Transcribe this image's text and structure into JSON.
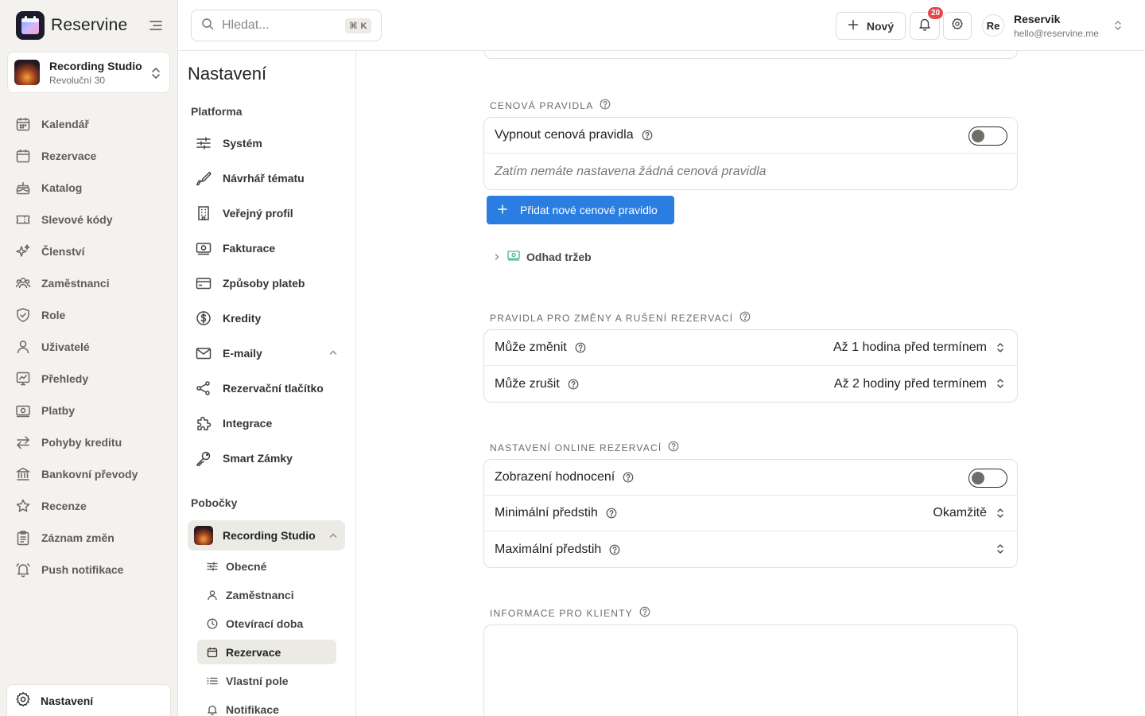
{
  "app": {
    "name": "Reservine"
  },
  "studio": {
    "name": "Recording Studio",
    "address": "Revoluční 30"
  },
  "nav": {
    "items": [
      {
        "label": "Kalendář",
        "icon": "calendar-icon"
      },
      {
        "label": "Rezervace",
        "icon": "calendar-check-icon"
      },
      {
        "label": "Katalog",
        "icon": "cake-icon"
      },
      {
        "label": "Slevové kódy",
        "icon": "ticket-icon"
      },
      {
        "label": "Členství",
        "icon": "sparkles-icon"
      },
      {
        "label": "Zaměstnanci",
        "icon": "users-icon"
      },
      {
        "label": "Role",
        "icon": "shield-icon"
      },
      {
        "label": "Uživatelé",
        "icon": "user-icon"
      },
      {
        "label": "Přehledy",
        "icon": "chart-icon"
      },
      {
        "label": "Platby",
        "icon": "banknote-icon"
      },
      {
        "label": "Pohyby kreditu",
        "icon": "arrows-icon"
      },
      {
        "label": "Bankovní převody",
        "icon": "bank-icon"
      },
      {
        "label": "Recenze",
        "icon": "star-icon"
      },
      {
        "label": "Záznam změn",
        "icon": "clipboard-icon"
      },
      {
        "label": "Push notifikace",
        "icon": "bell-ring-icon"
      }
    ],
    "bottom": {
      "label": "Nastavení",
      "icon": "gear-icon"
    }
  },
  "topbar": {
    "search_placeholder": "Hledat...",
    "shortcut": "⌘ K",
    "new_label": "Nový",
    "notification_count": "20",
    "user_initials": "Re",
    "user_name": "Reservik",
    "user_email": "hello@reservine.me"
  },
  "settings": {
    "title": "Nastavení",
    "platform_header": "Platforma",
    "platform_items": [
      {
        "label": "Systém",
        "icon": "sliders-icon"
      },
      {
        "label": "Návrhář tématu",
        "icon": "brush-icon"
      },
      {
        "label": "Veřejný profil",
        "icon": "building-icon"
      },
      {
        "label": "Fakturace",
        "icon": "invoice-icon"
      },
      {
        "label": "Způsoby plateb",
        "icon": "credit-card-icon"
      },
      {
        "label": "Kredity",
        "icon": "dollar-circle-icon"
      },
      {
        "label": "E-maily",
        "icon": "mail-icon"
      },
      {
        "label": "Rezervační tlačítko",
        "icon": "share-icon"
      },
      {
        "label": "Integrace",
        "icon": "puzzle-icon"
      },
      {
        "label": "Smart Zámky",
        "icon": "key-icon"
      }
    ],
    "branches_header": "Pobočky",
    "branch_name": "Recording Studio",
    "branch_items": [
      {
        "label": "Obecné",
        "icon": "sliders-icon"
      },
      {
        "label": "Zaměstnanci",
        "icon": "user-icon"
      },
      {
        "label": "Otevírací doba",
        "icon": "clock-icon"
      },
      {
        "label": "Rezervace",
        "icon": "calendar-icon"
      },
      {
        "label": "Vlastní pole",
        "icon": "list-icon"
      },
      {
        "label": "Notifikace",
        "icon": "bell-icon"
      }
    ],
    "active_branch_item": "Rezervace"
  },
  "main": {
    "pricing": {
      "label": "CENOVÁ PRAVIDLA",
      "toggle_label": "Vypnout cenová pravidla",
      "toggle_on": false,
      "empty_text": "Zatím nemáte nastavena žádná cenová pravidla",
      "add_button": "Přidat nové cenové pravidlo",
      "estimate_label": "Odhad tržeb"
    },
    "changes": {
      "label": "PRAVIDLA PRO ZMĚNY A RUŠENÍ REZERVACÍ",
      "can_change_label": "Může změnit",
      "can_change_value": "Až 1 hodina před termínem",
      "can_cancel_label": "Může zrušit",
      "can_cancel_value": "Až 2 hodiny před termínem"
    },
    "online": {
      "label": "NASTAVENÍ ONLINE REZERVACÍ",
      "rating_label": "Zobrazení hodnocení",
      "rating_on": false,
      "min_label": "Minimální předstih",
      "min_value": "Okamžitě",
      "max_label": "Maximální předstih",
      "max_value": ""
    },
    "client_info": {
      "label": "INFORMACE PRO KLIENTY"
    }
  },
  "colors": {
    "primary": "#2a7de1",
    "badge": "#e5484d",
    "sidebar_bg": "#f3f2ee",
    "active_bg": "#ebeae4"
  }
}
